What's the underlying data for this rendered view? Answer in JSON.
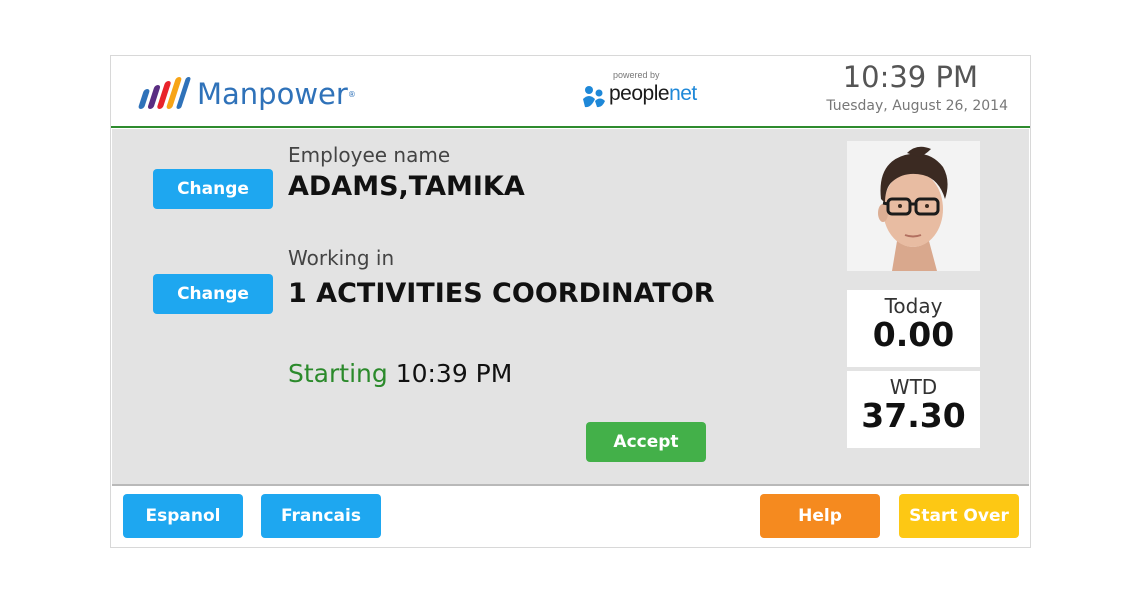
{
  "header": {
    "brand": "Manpower",
    "brand_mark": "®",
    "powered_by": "powered by",
    "partner_people": "people",
    "partner_net": "net",
    "time": "10:39 PM",
    "date": "Tuesday, August 26, 2014"
  },
  "employee": {
    "label": "Employee name",
    "value": "ADAMS,TAMIKA",
    "change_label": "Change"
  },
  "position": {
    "label": "Working in",
    "value": "1 ACTIVITIES COORDINATOR",
    "change_label": "Change"
  },
  "punch": {
    "word": "Starting",
    "time": "10:39 PM",
    "accept_label": "Accept"
  },
  "hours": {
    "today_label": "Today",
    "today_value": "0.00",
    "wtd_label": "WTD",
    "wtd_value": "37.30"
  },
  "footer": {
    "espanol": "Espanol",
    "francais": "Francais",
    "help": "Help",
    "start_over": "Start Over"
  },
  "colors": {
    "brand_blue": "#2f72b9",
    "accent_green": "#2e8b2e",
    "button_blue": "#1ea7f0",
    "button_green": "#43b049",
    "button_orange": "#f58a1f",
    "button_yellow": "#fdc814",
    "panel_gray": "#e3e3e3"
  },
  "icons": {
    "brand_logo": "manpower-stripes-icon",
    "partner_logo": "peoplenet-people-icon",
    "employee_photo": "employee-photo"
  }
}
